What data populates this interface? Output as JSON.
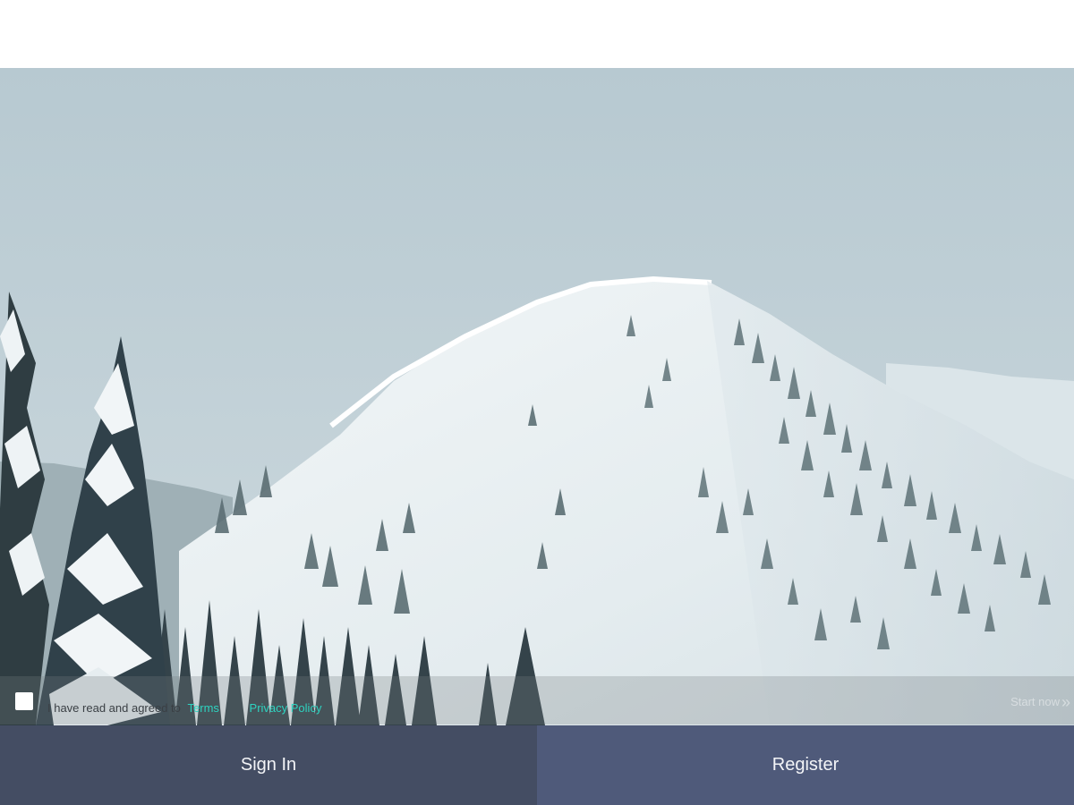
{
  "hero": {
    "image": "snowy-mountain-landscape"
  },
  "consent": {
    "prefix": "I have read and agreed to",
    "terms_label": "Terms",
    "privacy_label": "Privacy Policy",
    "checked": false
  },
  "start_now": {
    "label": "Start now",
    "icon": "double-chevron-right-icon"
  },
  "buttons": {
    "signin_label": "Sign In",
    "register_label": "Register"
  },
  "colors": {
    "signin_bg": "#444d63",
    "register_bg": "#4f5a7a",
    "link": "#2ed3c0"
  }
}
